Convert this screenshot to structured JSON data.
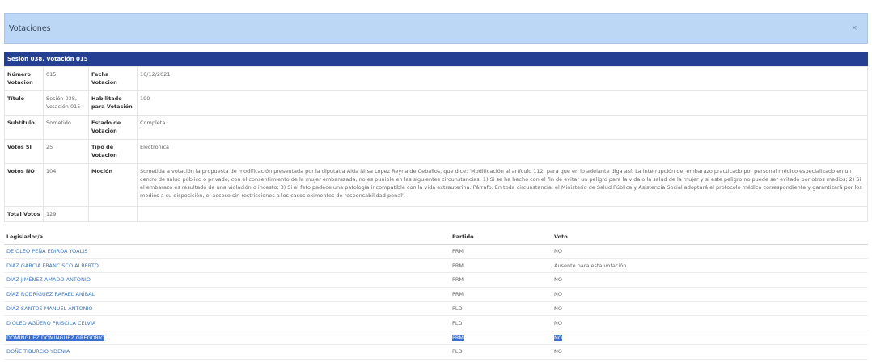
{
  "modal": {
    "title": "Votaciones",
    "close": "×"
  },
  "session": {
    "title": "Sesión 038, Votación 015"
  },
  "info": {
    "numero_label": "Número Votación",
    "numero_value": "015",
    "fecha_label": "Fecha Votación",
    "fecha_value": "16/12/2021",
    "titulo_label": "Título",
    "titulo_value": "Sesión 038, Votación 015",
    "habilitado_label": "Habilitado para Votación",
    "habilitado_value": "190",
    "subtitulo_label": "Subtítulo",
    "subtitulo_value": "Sometido",
    "estado_label": "Estado de Votación",
    "estado_value": "Completa",
    "si_label": "Votos SI",
    "si_value": "25",
    "tipo_label": "Tipo de Votación",
    "tipo_value": "Electrónica",
    "no_label": "Votos NO",
    "no_value": "104",
    "mocion_label": "Moción",
    "mocion_value": "Sometida a votación la propuesta de modificación presentada por la diputada Aida Nilsa López Reyna de Ceballos, que dice: 'Modificación al artículo 112, para que en lo adelante diga así: La interrupción del embarazo practicado por personal médico especializado en un centro de salud público o privado, con el consentimiento de la mujer embarazada, no es punible en las siguientes circunstancias: 1) Si se ha hecho con el fin de evitar un peligro para la vida o la salud de la mujer y si este peligro no puede ser evitado por otros medios; 2) Si el embarazo es resultado de una violación o incesto; 3) Si el feto padece una patología incompatible con la vida extrauterina. Párrafo. En toda circunstancia, el Ministerio de Salud Pública y Asistencia Social adoptará el protocolo médico correspondiente y garantizará por los medios a su disposición, el acceso sin restricciones a los casos eximentes de responsabilidad penal'.",
    "total_label": "Total Votos",
    "total_value": "129"
  },
  "votes": {
    "headers": {
      "legislador": "Legislador/a",
      "partido": "Partido",
      "voto": "Voto"
    },
    "rows": [
      {
        "name": "DE OLEO PEÑA EDIRDA YOALIS",
        "party": "PRM",
        "vote": "NO"
      },
      {
        "name": "DÍAZ GARCÍA FRANCISCO ALBERTO",
        "party": "PRM",
        "vote": "Ausente para esta votación"
      },
      {
        "name": "DÍAZ JIMÉNEZ AMADO ANTONIO",
        "party": "PRM",
        "vote": "NO"
      },
      {
        "name": "DÍAZ RODRÍGUEZ RAFAEL ANÍBAL",
        "party": "PRM",
        "vote": "NO"
      },
      {
        "name": "DÍAZ SANTOS MANUEL ANTONIO",
        "party": "PLD",
        "vote": "NO"
      },
      {
        "name": "D'OLEO AGÜERO PRISCILA CELVIA",
        "party": "PLD",
        "vote": "NO"
      },
      {
        "name": "DOMÍNGUEZ DOMÍNGUEZ GREGORIO",
        "party": "PRM",
        "vote": "NO"
      },
      {
        "name": "DOÑE TIBURCIO YDENIA",
        "party": "PLD",
        "vote": "NO"
      }
    ]
  },
  "colors": {
    "header_bg": "#bcd6f5",
    "session_bar": "#253f93",
    "link": "#3d77c6",
    "selection": "#3b6fd0"
  }
}
